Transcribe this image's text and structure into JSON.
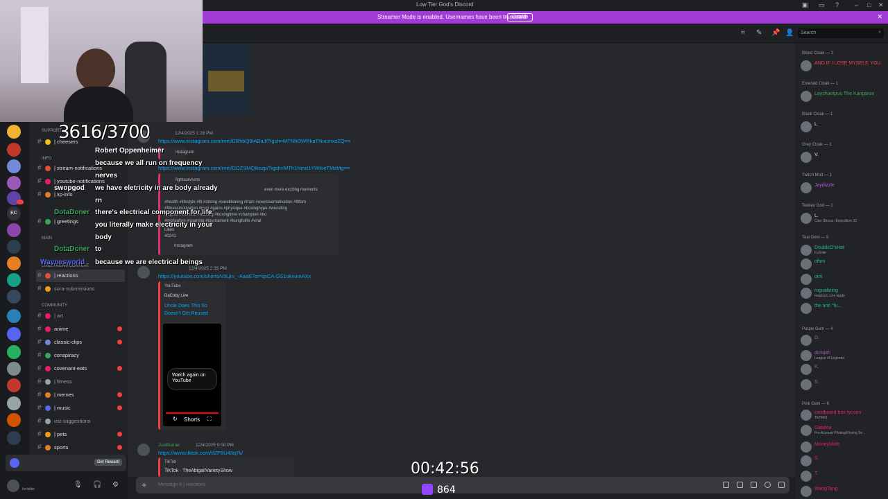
{
  "window": {
    "title": "Low Tier God's Discord"
  },
  "banner": {
    "text": "Streamer Mode is enabled. Usernames have been truncated.",
    "button": "Disable"
  },
  "header": {
    "search_placeholder": "Search"
  },
  "overlay": {
    "counter": "3616/3700",
    "timer": "00:42:56",
    "viewers": "864",
    "captions": [
      {
        "name": "Robert Oppenheimer",
        "text": "",
        "color": "#ffffff"
      },
      {
        "name": "",
        "text": "because we all run on frequency",
        "color": "#ffffff"
      },
      {
        "name": "",
        "text": "nerves",
        "color": "#ffffff"
      },
      {
        "name": "swopgod",
        "text": "we have eletricity in are body already",
        "color": "#ffffff"
      },
      {
        "name": "",
        "text": "rn",
        "color": "#ffffff"
      },
      {
        "name": "DotaDoner",
        "text": "there's electrical component for life",
        "color": "#3ba55d"
      },
      {
        "name": "",
        "text": "you literally make electricity in your",
        "color": "#ffffff"
      },
      {
        "name": "",
        "text": "body",
        "color": "#ffffff"
      },
      {
        "name": "DotaDoner",
        "text": "to",
        "color": "#3ba55d"
      },
      {
        "name": "Waynesworld",
        "text": "because we are electrical beings",
        "color": "#5865f2"
      }
    ]
  },
  "channels": {
    "categories": [
      "SUPPORT",
      "INFO",
      "MAIN",
      "LIVESTREAM CONTENT",
      "COMMUNITY"
    ],
    "items": [
      {
        "label": "| cheesers",
        "unread": false,
        "bright": true
      },
      {
        "label": "| stream-notifications",
        "unread": false,
        "bright": true
      },
      {
        "label": "| youtube-notifications",
        "unread": false,
        "bright": true
      },
      {
        "label": "| xp-info",
        "unread": false,
        "bright": true
      },
      {
        "label": "| greetings",
        "unread": false,
        "bright": true
      },
      {
        "label": "| reactions",
        "unread": false,
        "bright": true,
        "active": true
      },
      {
        "label": "sora-submissions",
        "unread": false,
        "bright": false
      },
      {
        "label": "| art",
        "unread": false,
        "bright": false
      },
      {
        "label": "anime",
        "unread": true,
        "bright": true
      },
      {
        "label": "classic-clips",
        "unread": true,
        "bright": true
      },
      {
        "label": "conspiracy",
        "unread": false,
        "bright": true
      },
      {
        "label": "covenant-eats",
        "unread": true,
        "bright": true
      },
      {
        "label": "| fitness",
        "unread": false,
        "bright": false
      },
      {
        "label": "| memes",
        "unread": true,
        "bright": true
      },
      {
        "label": "| music",
        "unread": true,
        "bright": true
      },
      {
        "label": "ost-suggestions",
        "unread": false,
        "bright": false
      },
      {
        "label": "| pets",
        "unread": true,
        "bright": true
      },
      {
        "label": "sports",
        "unread": true,
        "bright": true
      }
    ]
  },
  "userpanel": {
    "get_rewards": "Get Reward",
    "status": "Invisible"
  },
  "messages": [
    {
      "time": "12/4/2025 1:28 PM",
      "links": [
        "https://www.instagram.com/reel/DRhbQ9tABaJ/?igsh=MTNhOWRkaTNncmxzZQ==",
        "https://www.instagram.com/reel/DOZSMQIkszp/?igsh=MTh1Nmd1YWloeTMzMg=="
      ],
      "embed_lines": [
        "Instagram",
        "fightsurvivors",
        "even more exciting moments",
        "#health #lifestyle #fit #strong #conditioning #train #exercisemotivation #fitfam",
        "#fitnessmotivation #gym #gains #physique #boxinghype #wrestling",
        "#jiujitsu #workout #training #boxingtime #champion #ko",
        "#motivation #sparring #tournament #kungfulife #viral",
        "Likes",
        "40241",
        "Instagram"
      ]
    },
    {
      "time": "12/4/2025 2:35 PM",
      "link": "https://youtube.com/shorts/v3Ljm_-AaaE?si=qsCA-DS1okxumAXx",
      "provider": "YouTube",
      "author": "DaCoby Live",
      "title": "Uncle Does This So",
      "title2": "Doesn't Get Reused",
      "watch": "Watch again on YouTube",
      "shorts": "Shorts"
    },
    {
      "user": "JustBurner",
      "time": "12/4/2025 5:08 PM",
      "link": "https://www.tiktok.com/t/ZP8U43q7k/",
      "provider": "TikTok",
      "title": "TikTok · TheAbigailVarietyShow"
    }
  ],
  "composer": {
    "placeholder": "Message # | reactions"
  },
  "members": {
    "roles": [
      {
        "name": "Blood Cloak — 1"
      },
      {
        "name": "Emerald Cloak — 1"
      },
      {
        "name": "Black Cloak — 1"
      },
      {
        "name": "Grey Cloak — 1"
      },
      {
        "name": "Twitch Mod — 1"
      },
      {
        "name": "Tekken God — 1"
      },
      {
        "name": "Teal Gem — 5"
      },
      {
        "name": "Purple Gem — 4"
      },
      {
        "name": "Pink Gem — 6"
      }
    ],
    "list": [
      {
        "name": "AND IF I LOSE MYSELF, YOU",
        "sub": "",
        "color": "#f23f43"
      },
      {
        "name": "Laychampuu The Kangaroo",
        "sub": "",
        "color": "#3ba55d"
      },
      {
        "name": "L.",
        "sub": "",
        "color": "#dbdee1"
      },
      {
        "name": "V.",
        "sub": "",
        "color": "#dbdee1"
      },
      {
        "name": "Jaydizzle",
        "sub": "",
        "color": "#b15ce0"
      },
      {
        "name": "L.",
        "sub": "Clair Obscur: Expedition 33",
        "color": "#dbdee1"
      },
      {
        "name": "DoubleD'sHat",
        "sub": "Fortnite",
        "color": "#1abc9c"
      },
      {
        "name": "often",
        "sub": "",
        "color": "#1abc9c"
      },
      {
        "name": "omi",
        "sub": "",
        "color": "#1abc9c"
      },
      {
        "name": "rogualizing",
        "sub": "magnum.com laude",
        "color": "#1abc9c"
      },
      {
        "name": "the anti \"fu...",
        "sub": "",
        "color": "#1abc9c"
      },
      {
        "name": "D.",
        "sub": "",
        "color": "#9b59b6"
      },
      {
        "name": "dcmpth",
        "sub": "League of Legends",
        "color": "#9b59b6"
      },
      {
        "name": "K.",
        "sub": "",
        "color": "#9b59b6"
      },
      {
        "name": "S.",
        "sub": "",
        "color": "#9b59b6"
      },
      {
        "name": "cardboard box tycoon",
        "sub": "TETRIO",
        "color": "#e91e63"
      },
      {
        "name": "Galatea",
        "sub": "Pro Account Piloting/Driving Se...",
        "color": "#e91e63"
      },
      {
        "name": "MoneyMoltt",
        "sub": "",
        "color": "#e91e63"
      },
      {
        "name": "S.",
        "sub": "",
        "color": "#e91e63"
      },
      {
        "name": "T.",
        "sub": "",
        "color": "#e91e63"
      },
      {
        "name": "WangTang",
        "sub": "",
        "color": "#e91e63"
      }
    ]
  },
  "colors": {
    "accent": "#a23bd6",
    "link": "#00a8fc",
    "unread": "#f23f43"
  }
}
